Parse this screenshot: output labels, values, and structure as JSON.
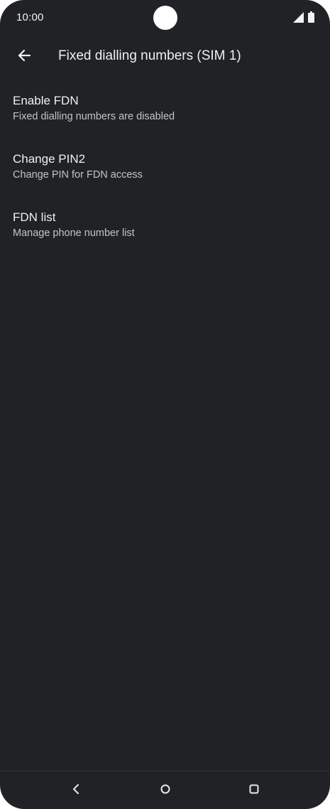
{
  "status_bar": {
    "time": "10:00",
    "icons": [
      "signal-icon",
      "battery-icon"
    ]
  },
  "app_bar": {
    "back_icon": "arrow-back-icon",
    "title": "Fixed dialling numbers (SIM 1)"
  },
  "preferences": [
    {
      "title": "Enable FDN",
      "summary": "Fixed dialling numbers are disabled"
    },
    {
      "title": "Change PIN2",
      "summary": "Change PIN for FDN access"
    },
    {
      "title": "FDN list",
      "summary": "Manage phone number list"
    }
  ],
  "nav_bar": {
    "buttons": [
      "nav-back-icon",
      "nav-home-icon",
      "nav-recents-icon"
    ]
  },
  "colors": {
    "background": "#212226",
    "text_primary": "#f0f0f2",
    "text_secondary": "#c3c4c8"
  }
}
